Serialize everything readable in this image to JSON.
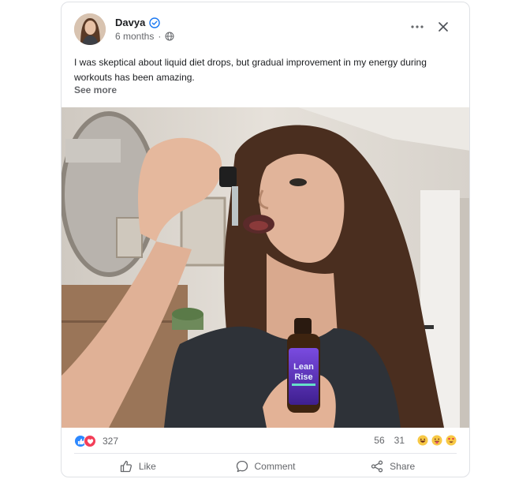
{
  "post": {
    "author": "Davya",
    "time": "6 months",
    "text": "I was skeptical about liquid diet drops, but gradual improvement in my energy during workouts has been amazing.",
    "see_more": "See more"
  },
  "product": {
    "brand_line1": "Lean",
    "brand_line2": "Rise"
  },
  "stats": {
    "reactions_count": "327",
    "comments_count": "56",
    "shares_count": "31"
  },
  "actions": {
    "like": "Like",
    "comment": "Comment",
    "share": "Share"
  },
  "colors": {
    "verified": "#1877f2",
    "like_reaction": "#2d88ff",
    "love_reaction": "#f33e58",
    "bottle_label": "#6b3fd4"
  },
  "icons": [
    "verified-badge-icon",
    "globe-icon",
    "more-options-icon",
    "close-icon",
    "like-reaction-icon",
    "love-reaction-icon",
    "thumbs-up-icon",
    "comment-icon",
    "share-icon"
  ]
}
